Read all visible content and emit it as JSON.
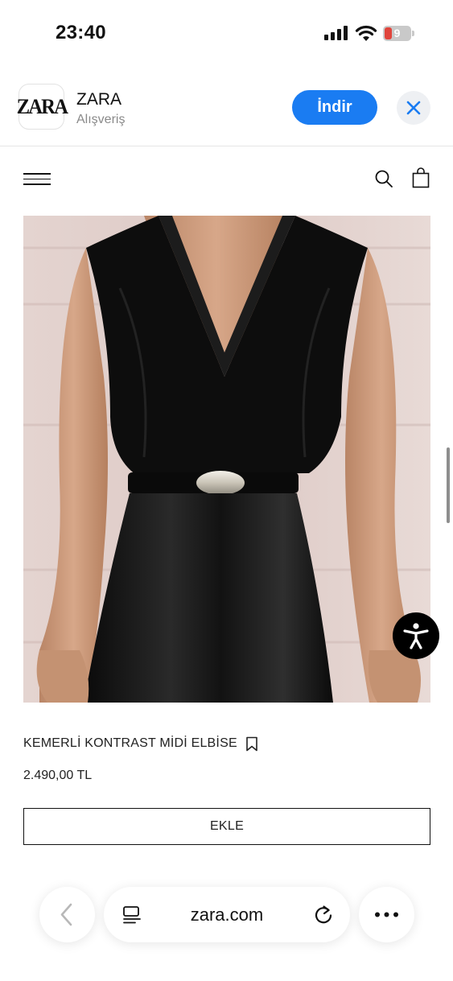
{
  "status_bar": {
    "time": "23:40",
    "battery_level": "9",
    "icons": [
      "signal-icon",
      "wifi-icon",
      "battery-icon"
    ]
  },
  "app_banner": {
    "logo_text": "ZARA",
    "app_name": "ZARA",
    "category": "Alışveriş",
    "install_label": "İndir",
    "accent_color": "#1a7cf2",
    "close_icon": "close-icon"
  },
  "header": {
    "icons": [
      "menu-icon",
      "search-icon",
      "shopping-bag-icon"
    ]
  },
  "product": {
    "name": "KEMERLİ KONTRAST MİDİ ELBİSE",
    "price": "2.490,00 TL",
    "add_label": "EKLE",
    "image_subject": "black sleeveless wrap dress with leather belt",
    "bookmark_icon": "bookmark-icon"
  },
  "accessibility": {
    "icon": "accessibility-icon"
  },
  "browser": {
    "url": "zara.com",
    "icons": [
      "back-arrow-icon",
      "reader-icon",
      "reload-icon",
      "more-icon"
    ]
  }
}
